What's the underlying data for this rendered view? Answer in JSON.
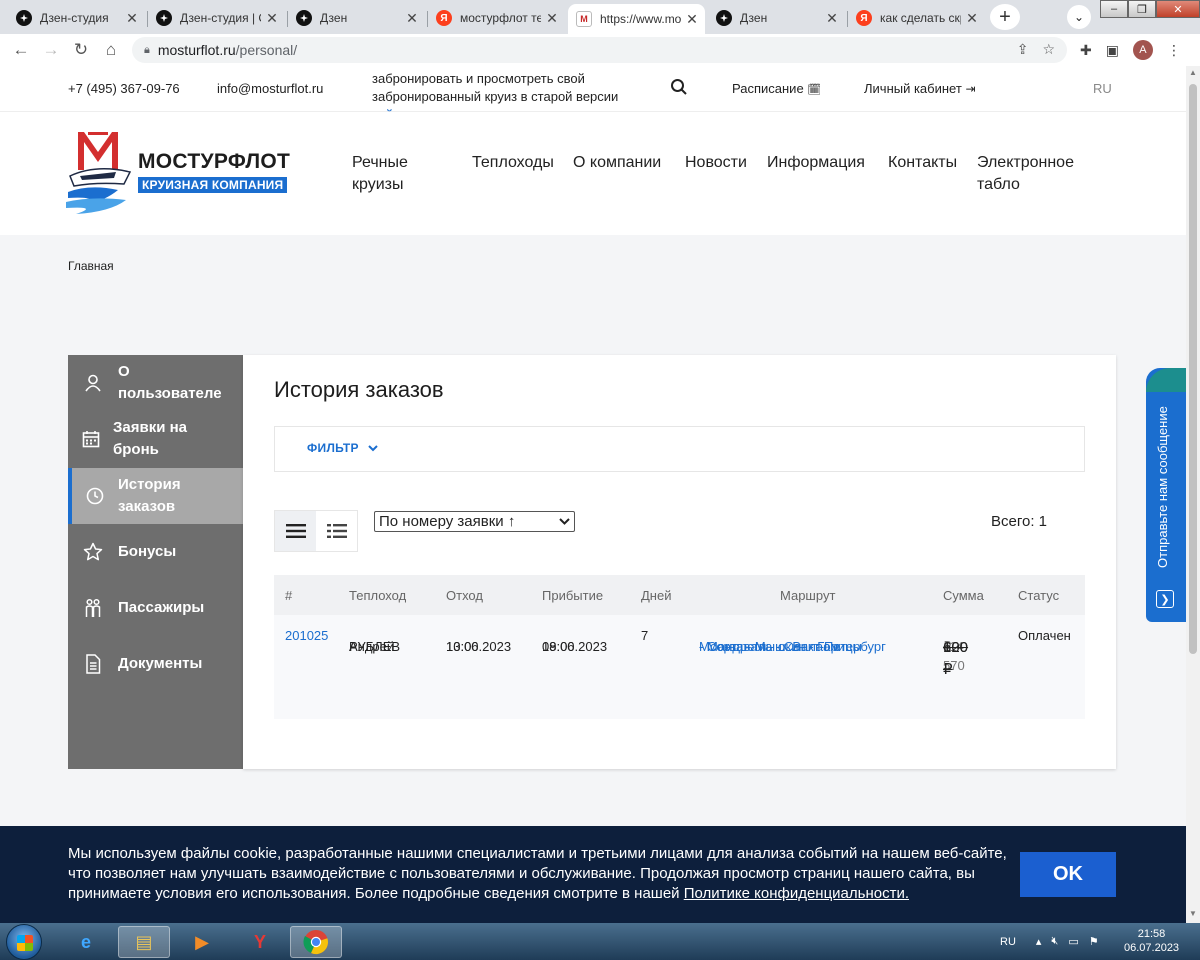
{
  "browser": {
    "tabs": [
      {
        "title": "Дзен-студия",
        "favicon": "dzen-icon"
      },
      {
        "title": "Дзен-студия | С",
        "favicon": "dzen-icon"
      },
      {
        "title": "Дзен",
        "favicon": "dzen-icon"
      },
      {
        "title": "мостурфлот теп",
        "favicon": "yandex-icon"
      },
      {
        "title": "https://www.mo",
        "favicon": "mosturflot-icon",
        "active": true
      },
      {
        "title": "Дзен",
        "favicon": "dzen-icon"
      },
      {
        "title": "как сделать скр",
        "favicon": "yandex-icon"
      }
    ],
    "url_host": "mosturflot.ru",
    "url_path": "/personal/",
    "profile_initial": "A"
  },
  "topbar": {
    "phone": "+7 (495) 367-09-76",
    "email": "info@mosturflot.ru",
    "notice_text": "забронировать и просмотреть свой забронированный круиз в старой версии",
    "notice_link": "сайта",
    "notice_end": ".",
    "schedule": "Расписание",
    "cabinet": "Личный кабинет",
    "lang": "RU"
  },
  "logo": {
    "brand": "МОСТУРФЛОТ",
    "tagline": "КРУИЗНАЯ КОМПАНИЯ"
  },
  "nav": {
    "cruises_1": "Речные",
    "cruises_2": "круизы",
    "ships": "Теплоходы",
    "about": "О компании",
    "news": "Новости",
    "info": "Информация",
    "contacts": "Контакты",
    "board_1": "Электронное",
    "board_2": "табло"
  },
  "breadcrumb": "Главная",
  "sidebar": {
    "about_1": "О",
    "about_2": "пользователе",
    "requests_1": "Заявки на",
    "requests_2": "бронь",
    "history_1": "История",
    "history_2": "заказов",
    "bonuses": "Бонусы",
    "passengers": "Пассажиры",
    "documents": "Документы"
  },
  "orders": {
    "title": "История заказов",
    "filter_label": "ФИЛЬТР",
    "sort_selected": "По номеру заявки ↑",
    "total": "Всего: 1",
    "columns": {
      "num": "#",
      "ship": "Теплоход",
      "depart": "Отход",
      "arrive": "Прибытие",
      "days": "Дней",
      "route": "Маршрут",
      "sum": "Сумма",
      "status": "Статус"
    },
    "row": {
      "num": "201025",
      "ship_1": "Андрей",
      "ship_2": "РУБЛЕВ",
      "depart_date": "13.06.2023",
      "depart_time": "10:00",
      "arrive_date": "19.06.2023",
      "arrive_time": "08:00",
      "days": "7",
      "route_1": "Москва -  Мышкин -  Горицы",
      "route_2": " -  Мандроги -  о. Валаам",
      "route_3": " -  Сортавала -  Санкт-Петербург",
      "sum_1": "114 570",
      "sum_2": "₽",
      "old_1": "120",
      "old_2": "600 ₽",
      "status": "Оплачен"
    }
  },
  "feedback_tab": "Отправьте нам сообщение",
  "cookie": {
    "text": "Мы используем файлы cookie, разработанные нашими специалистами и третьими лицами для анализа событий на нашем веб-сайте, что позволяет нам улучшать взаимодействие с пользователями и обслуживание. Продолжая просмотр страниц нашего сайта, вы принимаете условия его использования. Более подробные сведения смотрите в нашей",
    "link": "Политике конфиденциальности.",
    "ok": "OK"
  },
  "taskbar": {
    "lang": "RU",
    "time": "21:58",
    "date": "06.07.2023"
  },
  "colors": {
    "accent": "#1b6ecf",
    "sidebar": "#6e6e6e",
    "cookie_bg": "#0d1f3c"
  }
}
